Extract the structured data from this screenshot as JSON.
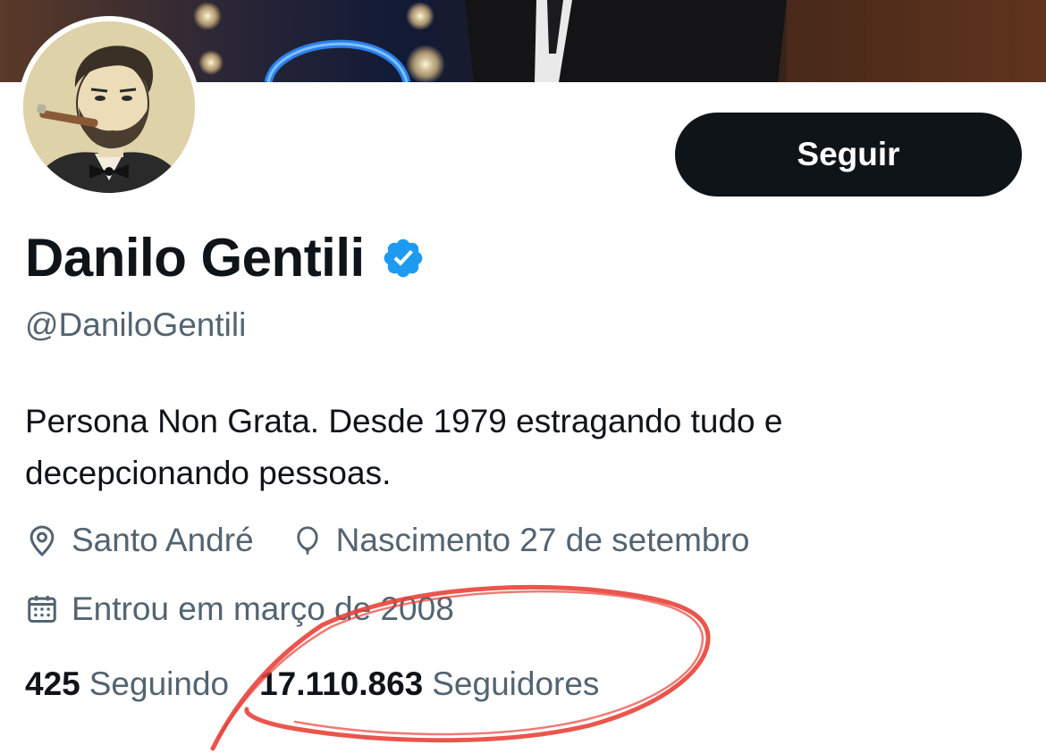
{
  "profile": {
    "display_name": "Danilo Gentili",
    "handle": "@DaniloGentili",
    "bio": "Persona Non Grata. Desde 1979 estragando tudo e decepcionando pessoas.",
    "follow_label": "Seguir",
    "verified_icon": "verified-badge-icon",
    "location": "Santo André",
    "birthday": "Nascimento 27 de setembro",
    "joined": "Entrou em março de 2008"
  },
  "stats": {
    "following_count": "425",
    "following_label": "Seguindo",
    "followers_count": "17.110.863",
    "followers_label": "Seguidores"
  },
  "colors": {
    "text_primary": "#0f1419",
    "text_secondary": "#536471",
    "verified_blue": "#1d9bf0",
    "button_bg": "#0f1419",
    "annotation_red": "#e8423a"
  }
}
